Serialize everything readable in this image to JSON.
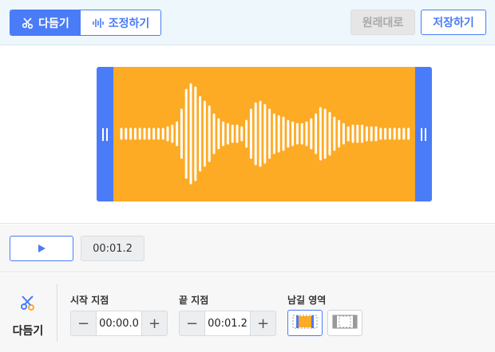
{
  "toolbar": {
    "modes": [
      {
        "label": "다듬기",
        "icon": "scissors-icon",
        "active": true
      },
      {
        "label": "조정하기",
        "icon": "waveform-icon",
        "active": false
      }
    ],
    "revert_label": "원래대로",
    "save_label": "저장하기",
    "accent_color": "#4a7cf7"
  },
  "waveform": {
    "selection_color": "#fdaa25",
    "handle_color": "#4a7cf7",
    "handle_icon": "grip-icon"
  },
  "playback": {
    "play_icon": "play-icon",
    "current_time": "00:01.2"
  },
  "controls": {
    "tool_label": "다듬기",
    "tool_icon": "scissors-icon",
    "start": {
      "label": "시작 지점",
      "value": "00:00.0",
      "minus": "−",
      "plus": "+"
    },
    "end": {
      "label": "끝 지점",
      "value": "00:01.2",
      "minus": "−",
      "plus": "+"
    },
    "keep": {
      "label": "남길 영역",
      "options": [
        {
          "icon": "keep-inside-icon",
          "selected": true
        },
        {
          "icon": "keep-outside-icon",
          "selected": false
        }
      ]
    }
  }
}
